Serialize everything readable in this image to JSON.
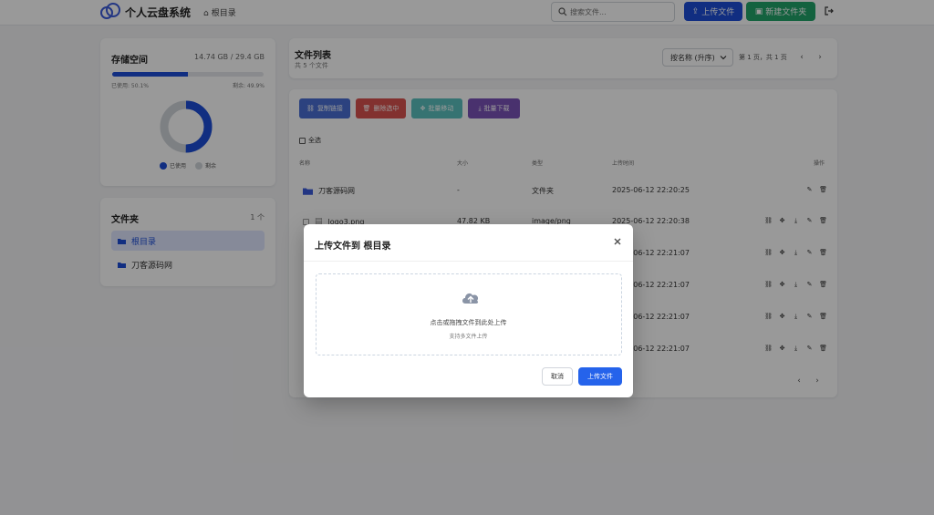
{
  "header": {
    "brand": "个人云盘系统",
    "breadcrumb": "根目录",
    "search_placeholder": "搜索文件...",
    "upload_label": "上传文件",
    "new_folder_label": "新建文件夹"
  },
  "storage": {
    "title": "存储空间",
    "capacity": "14.74 GB / 29.4 GB",
    "used_text": "已使用: 50.1%",
    "free_text": "剩余: 49.9%",
    "used_fraction": 0.501,
    "legend_used": "已使用",
    "legend_free": "剩余",
    "used_color": "#1d4ed8",
    "free_color": "#d1d5db"
  },
  "folders": {
    "title": "文件夹",
    "count": "1 个",
    "items": [
      {
        "label": "根目录",
        "active": true
      },
      {
        "label": "刀客源码网",
        "active": false
      }
    ]
  },
  "file_list": {
    "title": "文件列表",
    "subtitle": "共 5 个文件",
    "sort_selected": "按名称 (升序)",
    "page_info": "第 1 页，共 1 页",
    "batch_buttons": [
      {
        "label": "复制链接",
        "color": "#4a6fd4"
      },
      {
        "label": "删除选中",
        "color": "#d9534f"
      },
      {
        "label": "批量移动",
        "color": "#5bc0be"
      },
      {
        "label": "批量下载",
        "color": "#7b52b8"
      }
    ],
    "select_all": "全选",
    "columns": [
      "名称",
      "大小",
      "类型",
      "上传时间",
      "操作"
    ],
    "rows": [
      {
        "name": "刀客源码网",
        "size": "-",
        "type": "文件夹",
        "time": "2025-06-12 22:20:25",
        "is_folder": true
      },
      {
        "name": "logo3.png",
        "size": "47.82 KB",
        "type": "image/png",
        "time": "2025-06-12 22:20:38",
        "is_folder": false
      },
      {
        "name": "",
        "size": "",
        "type": "",
        "time": "2025-06-12 22:21:07",
        "is_folder": false
      },
      {
        "name": "",
        "size": "",
        "type": "",
        "time": "2025-06-12 22:21:07",
        "is_folder": false
      },
      {
        "name": "",
        "size": "",
        "type": "",
        "time": "2025-06-12 22:21:07",
        "is_folder": false
      },
      {
        "name": "",
        "size": "",
        "type": "",
        "time": "2025-06-12 22:21:07",
        "is_folder": false
      }
    ]
  },
  "modal": {
    "title": "上传文件到 根目录",
    "drop_hint": "点击或拖拽文件到此处上传",
    "drop_sub": "支持多文件上传",
    "cancel_label": "取消",
    "upload_label": "上传文件"
  }
}
